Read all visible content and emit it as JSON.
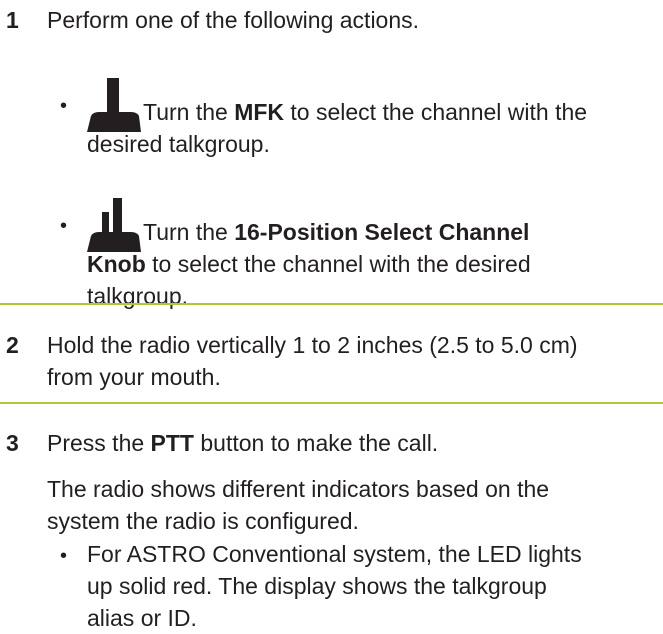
{
  "step1": {
    "number": "1",
    "text": "Perform one of the following actions.",
    "bullet_symbol": "•",
    "option_a": {
      "icon": "radio-model-icon-single-antenna",
      "prefix": "Turn the ",
      "bold": "MFK",
      "suffix_line1": " to select the channel with the",
      "line2": "desired talkgroup."
    },
    "option_b": {
      "icon": "radio-model-icon-dual-antenna",
      "prefix": "Turn the ",
      "bold_line1": "16-Position Select Channel",
      "bold_line2": "Knob",
      "suffix_line2": " to select the channel with the desired",
      "line3": "talkgroup."
    }
  },
  "step2": {
    "number": "2",
    "line1": "Hold the radio vertically 1 to 2 inches (2.5 to 5.0 cm)",
    "line2": "from your mouth."
  },
  "step3": {
    "number": "3",
    "prefix": "Press the ",
    "bold": "PTT",
    "suffix": " button to make the call.",
    "note_line1": "The radio shows different indicators based on the",
    "note_line2": "system the radio is configured.",
    "bullet_symbol": "•",
    "bullet_line1": "For ASTRO Conventional system, the LED lights",
    "bullet_line2": "up solid red. The display shows the talkgroup",
    "bullet_line3": "alias or ID."
  },
  "colors": {
    "divider": "#b5c634",
    "text": "#231f20",
    "icon": "#231f20"
  }
}
